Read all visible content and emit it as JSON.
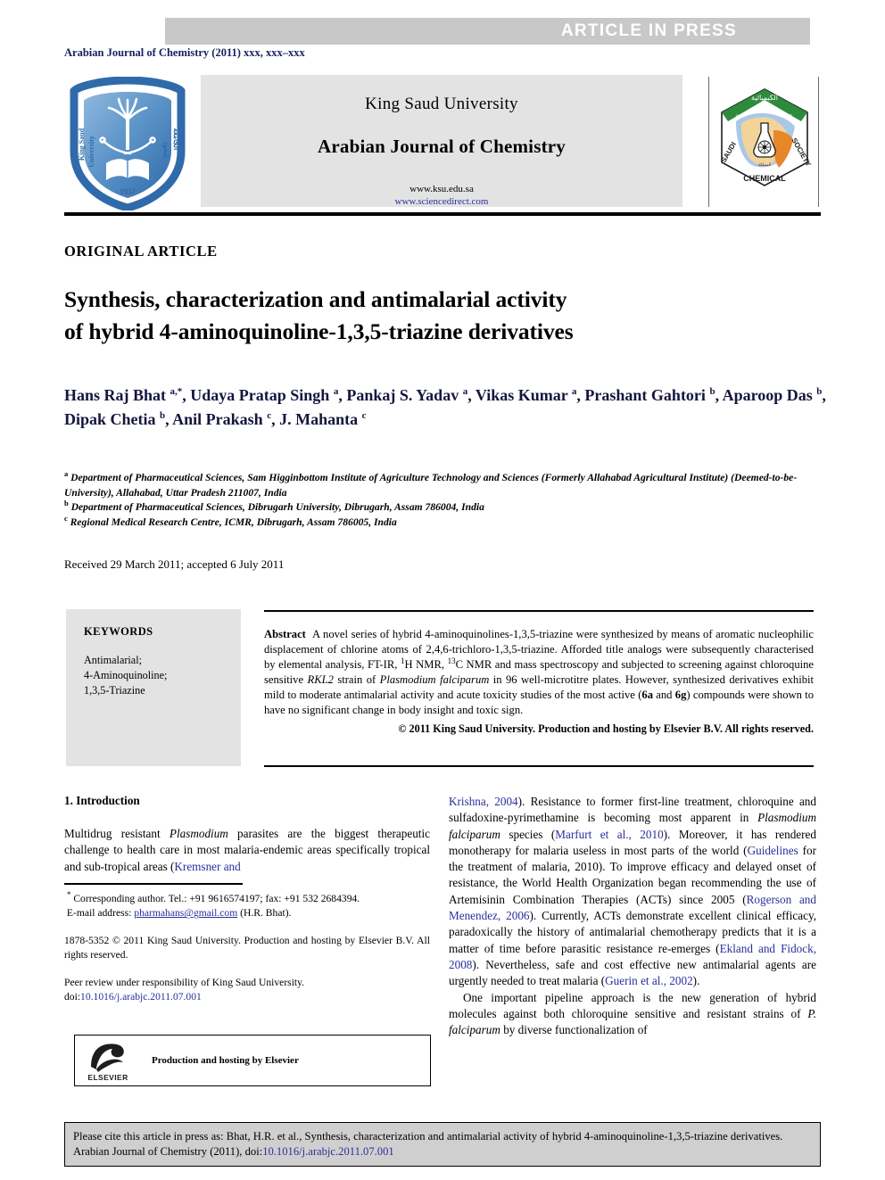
{
  "banner": {
    "text": "ARTICLE  IN  PRESS"
  },
  "journal_ref": "Arabian Journal of Chemistry (2011) xxx, xxx–xxx",
  "masthead": {
    "publisher": "King Saud University",
    "journal_title": "Arabian Journal of Chemistry",
    "url_primary": "www.ksu.edu.sa",
    "url_secondary": "www.sciencedirect.com",
    "left_logo_name": "king-saud-university-shield-logo",
    "left_logo_text_top": "King Saud",
    "left_logo_text_bottom": "University",
    "left_logo_year": "1937",
    "right_logo_name": "saudi-chemical-society-logo",
    "right_logo_text_left": "SAUDI",
    "right_logo_text_right": "SOCIETY",
    "right_logo_text_bottom": "CHEMICAL"
  },
  "article_type": "ORIGINAL ARTICLE",
  "title_line1": "Synthesis, characterization and antimalarial activity",
  "title_line2": "of hybrid 4-aminoquinoline-1,3,5-triazine derivatives",
  "authors": [
    {
      "name": "Hans Raj Bhat",
      "marks": "a,*"
    },
    {
      "name": "Udaya Pratap Singh",
      "marks": "a"
    },
    {
      "name": "Pankaj S. Yadav",
      "marks": "a"
    },
    {
      "name": "Vikas Kumar",
      "marks": "a"
    },
    {
      "name": "Prashant Gahtori",
      "marks": "b"
    },
    {
      "name": "Aparoop Das",
      "marks": "b"
    },
    {
      "name": "Dipak Chetia",
      "marks": "b"
    },
    {
      "name": "Anil Prakash",
      "marks": "c"
    },
    {
      "name": "J. Mahanta",
      "marks": "c"
    }
  ],
  "affiliations": [
    {
      "mark": "a",
      "text": "Department of Pharmaceutical Sciences, Sam Higginbottom Institute of Agriculture Technology and Sciences (Formerly Allahabad Agricultural Institute) (Deemed-to-be-University), Allahabad, Uttar Pradesh 211007, India"
    },
    {
      "mark": "b",
      "text": "Department of Pharmaceutical Sciences, Dibrugarh University, Dibrugarh, Assam 786004, India"
    },
    {
      "mark": "c",
      "text": "Regional Medical Research Centre, ICMR, Dibrugarh, Assam 786005, India"
    }
  ],
  "dates": "Received 29 March 2011; accepted 6 July 2011",
  "keywords": {
    "heading": "KEYWORDS",
    "items": "Antimalarial;\n4-Aminoquinoline;\n1,3,5-Triazine"
  },
  "abstract": {
    "label": "Abstract",
    "copyright": "© 2011 King Saud University. Production and hosting by Elsevier B.V. All rights reserved."
  },
  "introduction": {
    "heading": "1. Introduction"
  },
  "footnotes": {
    "corresponding": "Corresponding author. Tel.: +91 9616574197; fax: +91 532 2684394.",
    "email_label": "E-mail address:",
    "email": "pharmahans@gmail.com",
    "email_owner": "(H.R. Bhat).",
    "issn_copyright": "1878-5352 © 2011 King Saud University. Production and hosting by Elsevier B.V. All rights reserved.",
    "peer_review": "Peer review under responsibility of King Saud University.",
    "doi_label": "doi:",
    "doi": "10.1016/j.arabjc.2011.07.001"
  },
  "elsevier": {
    "caption": "Production and hosting by Elsevier",
    "wordmark": "ELSEVIER"
  },
  "footer_citation": {
    "doi": "10.1016/j.arabjc.2011.07.001"
  },
  "colors": {
    "banner_bg": "#c8c8c8",
    "panel_bg": "#e3e3e3",
    "link_blue": "#2a2f9b",
    "journal_ref_blue": "#1b2161",
    "author_navy": "#15163f",
    "citation_box_bg": "#cfcfcf",
    "shield_blue": "#3b7cc4"
  }
}
